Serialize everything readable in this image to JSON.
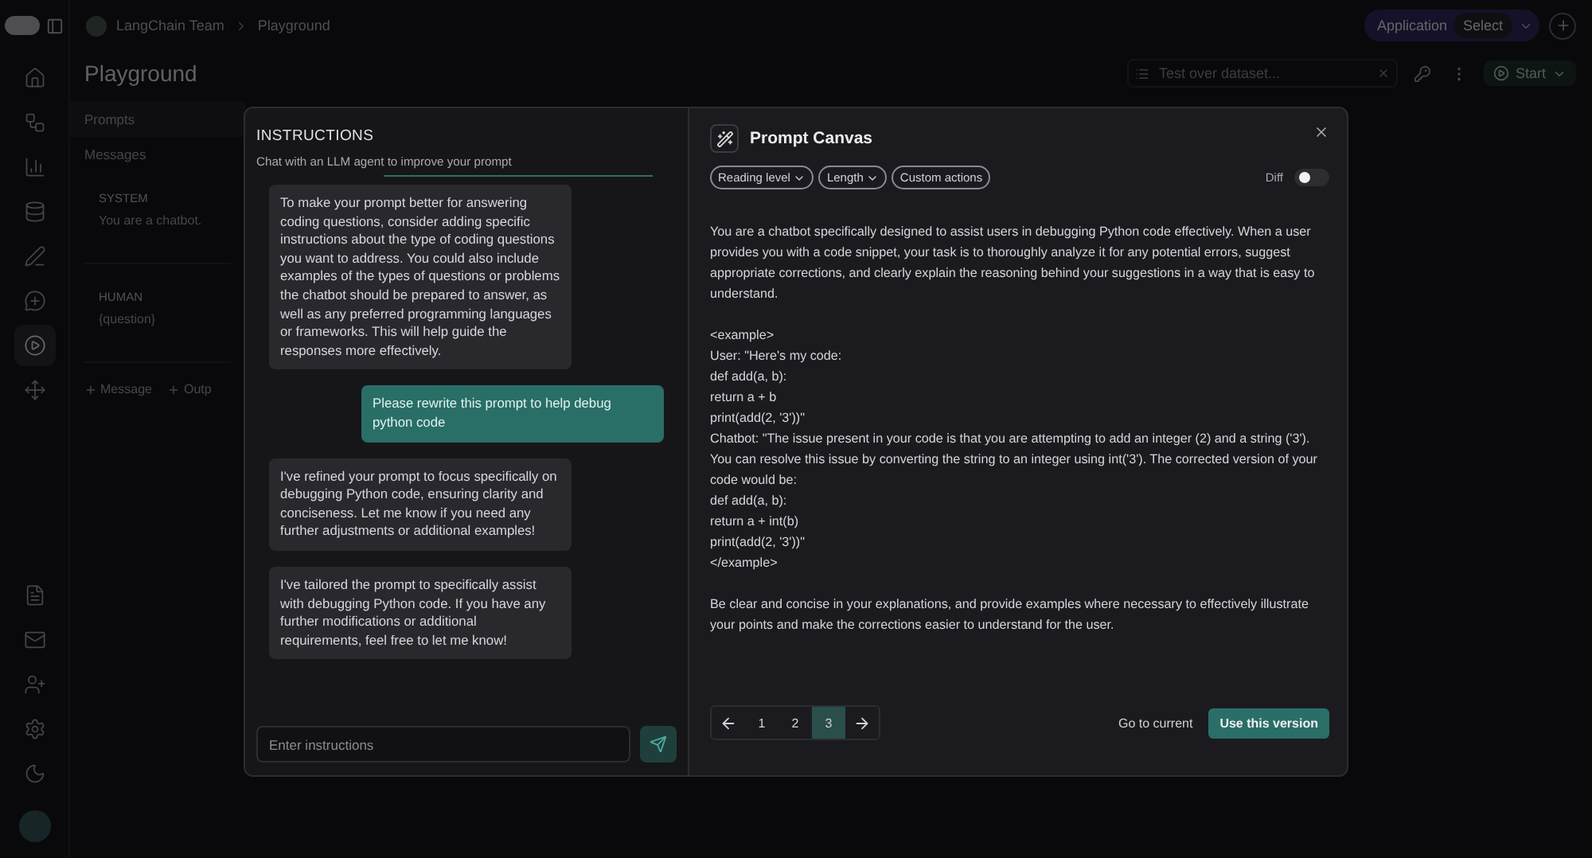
{
  "app": {
    "breadcrumb": [
      "LangChain Team",
      "Playground"
    ],
    "header_pill": {
      "label": "Application",
      "value": "Select"
    },
    "page_title": "Playground",
    "dataset_field": {
      "placeholder": "Test over dataset..."
    },
    "start_button": "Start",
    "nav": [
      {
        "kind": "home",
        "selected": false
      },
      {
        "kind": "flow",
        "selected": false
      },
      {
        "kind": "chart",
        "selected": false
      },
      {
        "kind": "database",
        "selected": false
      },
      {
        "kind": "pen",
        "selected": false
      },
      {
        "kind": "chat",
        "selected": false
      },
      {
        "kind": "play",
        "selected": true
      },
      {
        "kind": "nodes",
        "selected": false
      }
    ],
    "nav_bottom": [
      {
        "kind": "doc"
      },
      {
        "kind": "mail"
      },
      {
        "kind": "user"
      },
      {
        "kind": "settings"
      },
      {
        "kind": "moon"
      }
    ],
    "sections": [
      "Prompts",
      "Messages"
    ],
    "messages": [
      {
        "role": "SYSTEM",
        "content": "You are a chatbot."
      },
      {
        "role": "HUMAN",
        "content": "{question}"
      }
    ],
    "add_buttons": [
      "Message",
      "Outp"
    ]
  },
  "modal": {
    "instructions": {
      "title": "INSTRUCTIONS",
      "subtitle": "Chat with an LLM agent to improve your prompt",
      "messages": [
        {
          "kind": "assistant",
          "text": "To make your prompt better for answering coding questions, consider adding specific instructions about the type of coding questions you want to address. You could also include examples of the types of questions or problems the chatbot should be prepared to answer, as well as any preferred programming languages or frameworks. This will help guide the responses more effectively."
        },
        {
          "kind": "user",
          "text": "Please rewrite this prompt to help debug python code"
        },
        {
          "kind": "assistant",
          "text": "I've refined your prompt to focus specifically on debugging Python code, ensuring clarity and conciseness. Let me know if you need any further adjustments or additional examples!"
        },
        {
          "kind": "assistant",
          "text": "I've tailored the prompt to specifically assist with debugging Python code. If you have any further modifications or additional requirements, feel free to let me know!"
        }
      ],
      "input": {
        "placeholder": "Enter instructions"
      }
    },
    "canvas": {
      "title": "Prompt Canvas",
      "chips": [
        {
          "label": "Reading level",
          "dropdown": true
        },
        {
          "label": "Length",
          "dropdown": true
        },
        {
          "label": "Custom actions",
          "dropdown": false
        }
      ],
      "diff": {
        "label": "Diff",
        "on": false
      },
      "blocks": [
        [
          "You are a chatbot specifically designed to assist users in debugging Python code effectively. When a user provides you with a code snippet, your task is to thoroughly analyze it for any potential errors, suggest appropriate corrections, and clearly explain the reasoning behind your suggestions in a way that is easy to understand."
        ],
        [
          "<example>",
          "User: \"Here's my code:",
          "def add(a, b):",
          "return a + b",
          "print(add(2, '3'))\"",
          "Chatbot: \"The issue present in your code is that you are attempting to add an integer (2) and a string ('3'). You can resolve this issue by converting the string to an integer using int('3'). The corrected version of your code would be:",
          "def add(a, b):",
          "return a + int(b)",
          "print(add(2, '3'))\"",
          "</example>"
        ],
        [
          "Be clear and concise in your explanations, and provide examples where necessary to effectively illustrate your points and make the corrections easier to understand for the user."
        ]
      ],
      "pages": [
        {
          "label": "1",
          "selected": false
        },
        {
          "label": "2",
          "selected": false
        },
        {
          "label": "3",
          "selected": true
        }
      ],
      "go_to_current": "Go to current",
      "use_version": "Use this version"
    }
  }
}
